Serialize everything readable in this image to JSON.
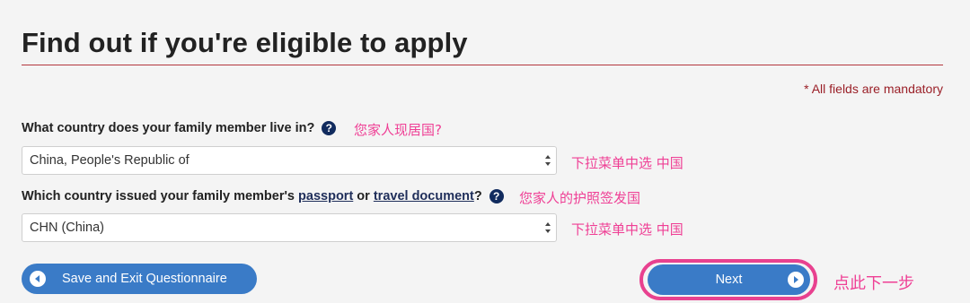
{
  "page": {
    "title": "Find out if you're eligible to apply",
    "mandatory_note": "* All fields are mandatory"
  },
  "q1": {
    "label": "What country does your family member live in?",
    "help": "?",
    "annotation": "您家人现居国?",
    "select_value": "China, People's Republic of",
    "select_annotation": "下拉菜单中选  中国"
  },
  "q2": {
    "label_part1": "Which country issued your family member's ",
    "link1": "passport",
    "label_part2": " or ",
    "link2": "travel document",
    "label_part3": "?",
    "help": "?",
    "annotation": "您家人的护照签发国",
    "select_value": "CHN (China)",
    "select_annotation": "下拉菜单中选  中国"
  },
  "buttons": {
    "save_label": "Save and Exit Questionnaire",
    "save_icon": "chevron-left-circle-icon",
    "next_label": "Next",
    "next_icon": "chevron-right-circle-icon",
    "next_annotation": "点此下一步"
  },
  "colors": {
    "accent": "#3a7bc7",
    "rule": "#b3363d",
    "annotation": "#ef3f95",
    "help_icon": "#112b5e"
  }
}
